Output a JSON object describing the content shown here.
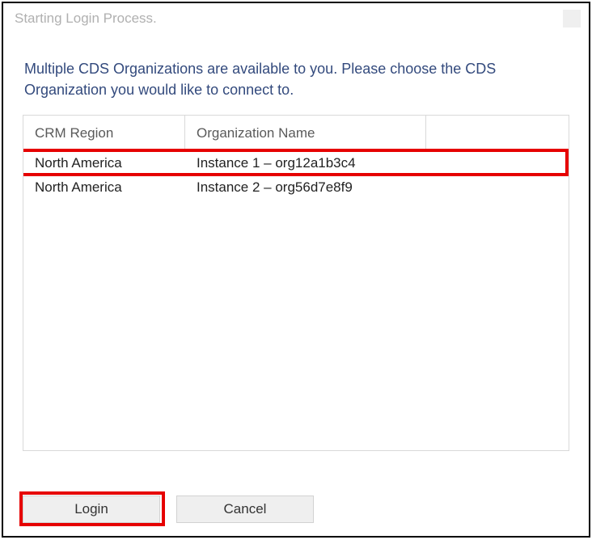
{
  "window": {
    "title": "Starting Login Process."
  },
  "instructions": "Multiple CDS Organizations are available to you. Please choose the CDS Organization you would like to connect to.",
  "grid": {
    "headers": {
      "region": "CRM Region",
      "org": "Organization Name"
    },
    "rows": [
      {
        "region": "North America",
        "org": "Instance 1 – org12a1b3c4"
      },
      {
        "region": "North America",
        "org": "Instance 2 – org56d7e8f9"
      }
    ]
  },
  "buttons": {
    "login": "Login",
    "cancel": "Cancel"
  }
}
